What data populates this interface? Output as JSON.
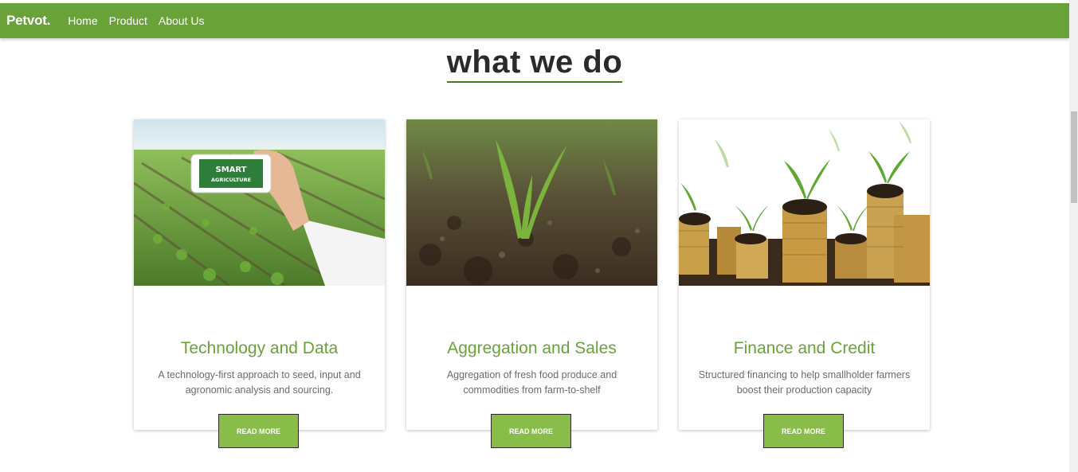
{
  "navbar": {
    "brand": "Petvot.",
    "links": [
      "Home",
      "Product",
      "About Us"
    ]
  },
  "section": {
    "title": "what we do"
  },
  "cards": [
    {
      "title": "Technology and Data",
      "description": "A technology-first approach to seed, input and agronomic analysis and sourcing.",
      "button": "READ MORE",
      "image_text": [
        "SMART",
        "AGRICULTURE"
      ]
    },
    {
      "title": "Aggregation and Sales",
      "description": "Aggregation of fresh food produce and commodities from farm-to-shelf",
      "button": "READ MORE"
    },
    {
      "title": "Finance and Credit",
      "description": "Structured financing to help smallholder farmers boost their production capacity",
      "button": "READ MORE"
    }
  ],
  "colors": {
    "navbar": "#6aa23a",
    "accent": "#6aa23a",
    "button": "#89bd4a"
  }
}
